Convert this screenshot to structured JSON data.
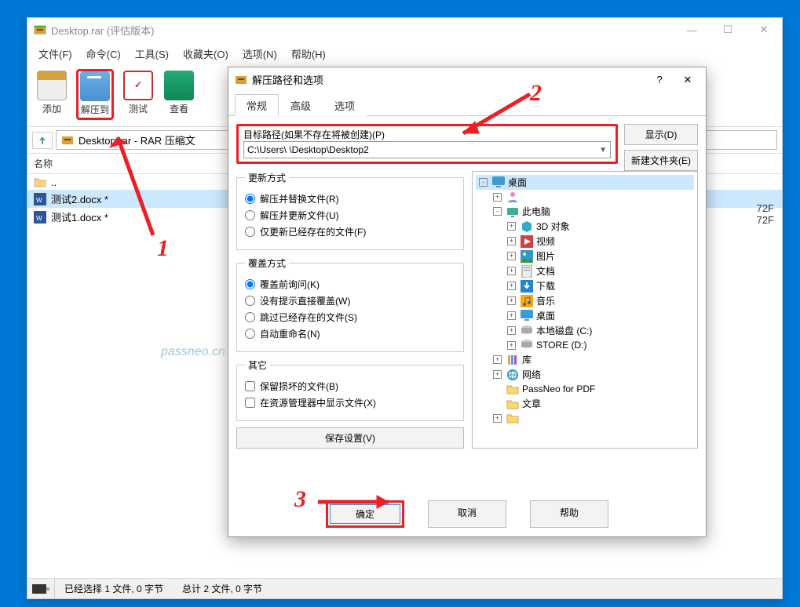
{
  "colors": {
    "accent_red": "#ec2024",
    "win_blue": "#0078d7"
  },
  "main": {
    "title": "Desktop.rar (评估版本)",
    "menu": [
      "文件(F)",
      "命令(C)",
      "工具(S)",
      "收藏夹(O)",
      "选项(N)",
      "帮助(H)"
    ],
    "toolbar": {
      "add": "添加",
      "extract": "解压到",
      "test": "测试",
      "view": "查看"
    },
    "path": "Desktop.rar - RAR 压缩文",
    "col_name": "名称",
    "files": [
      {
        "name": "..",
        "type": "up"
      },
      {
        "name": "测试2.docx *",
        "type": "docx",
        "sel": true
      },
      {
        "name": "测试1.docx *",
        "type": "docx",
        "sel": false
      }
    ],
    "status_left": "已经选择 1 文件, 0 字节",
    "status_right": "总计 2 文件, 0 字节",
    "right_vals": [
      "72F",
      "72F"
    ]
  },
  "dialog": {
    "title": "解压路径和选项",
    "tabs": [
      "常规",
      "高级",
      "选项"
    ],
    "dest_label": "目标路径(如果不存在将被创建)(P)",
    "dest_path": "C:\\Users\\        \\Desktop\\Desktop2",
    "btn_show": "显示(D)",
    "btn_newfolder": "新建文件夹(E)",
    "group_update": "更新方式",
    "update_opts": [
      "解压并替换文件(R)",
      "解压并更新文件(U)",
      "仅更新已经存在的文件(F)"
    ],
    "group_over": "覆盖方式",
    "over_opts": [
      "覆盖前询问(K)",
      "没有提示直接覆盖(W)",
      "跳过已经存在的文件(S)",
      "自动重命名(N)"
    ],
    "group_misc": "其它",
    "misc_opts": [
      "保留损坏的文件(B)",
      "在资源管理器中显示文件(X)"
    ],
    "btn_save": "保存设置(V)",
    "tree": [
      {
        "ind": 0,
        "exp": "-",
        "icon": "desktop",
        "label": "桌面",
        "sel": true
      },
      {
        "ind": 1,
        "exp": "+",
        "icon": "user",
        "label": ""
      },
      {
        "ind": 1,
        "exp": "-",
        "icon": "pc",
        "label": "此电脑"
      },
      {
        "ind": 2,
        "exp": "+",
        "icon": "3d",
        "label": "3D 对象"
      },
      {
        "ind": 2,
        "exp": "+",
        "icon": "video",
        "label": "视频"
      },
      {
        "ind": 2,
        "exp": "+",
        "icon": "pics",
        "label": "图片"
      },
      {
        "ind": 2,
        "exp": "+",
        "icon": "docs",
        "label": "文档"
      },
      {
        "ind": 2,
        "exp": "+",
        "icon": "down",
        "label": "下载"
      },
      {
        "ind": 2,
        "exp": "+",
        "icon": "music",
        "label": "音乐"
      },
      {
        "ind": 2,
        "exp": "+",
        "icon": "desktop",
        "label": "桌面"
      },
      {
        "ind": 2,
        "exp": "+",
        "icon": "disk",
        "label": "本地磁盘 (C:)"
      },
      {
        "ind": 2,
        "exp": "+",
        "icon": "disk",
        "label": "STORE (D:)"
      },
      {
        "ind": 1,
        "exp": "+",
        "icon": "lib",
        "label": "库"
      },
      {
        "ind": 1,
        "exp": "+",
        "icon": "net",
        "label": "网络"
      },
      {
        "ind": 1,
        "exp": " ",
        "icon": "folder",
        "label": "PassNeo for PDF"
      },
      {
        "ind": 1,
        "exp": " ",
        "icon": "folder",
        "label": "文章"
      },
      {
        "ind": 1,
        "exp": "+",
        "icon": "folder",
        "label": ""
      }
    ],
    "btn_ok": "确定",
    "btn_cancel": "取消",
    "btn_help": "帮助"
  },
  "annotations": {
    "n1": "1",
    "n2": "2",
    "n3": "3"
  },
  "watermark": "passneo.cn"
}
